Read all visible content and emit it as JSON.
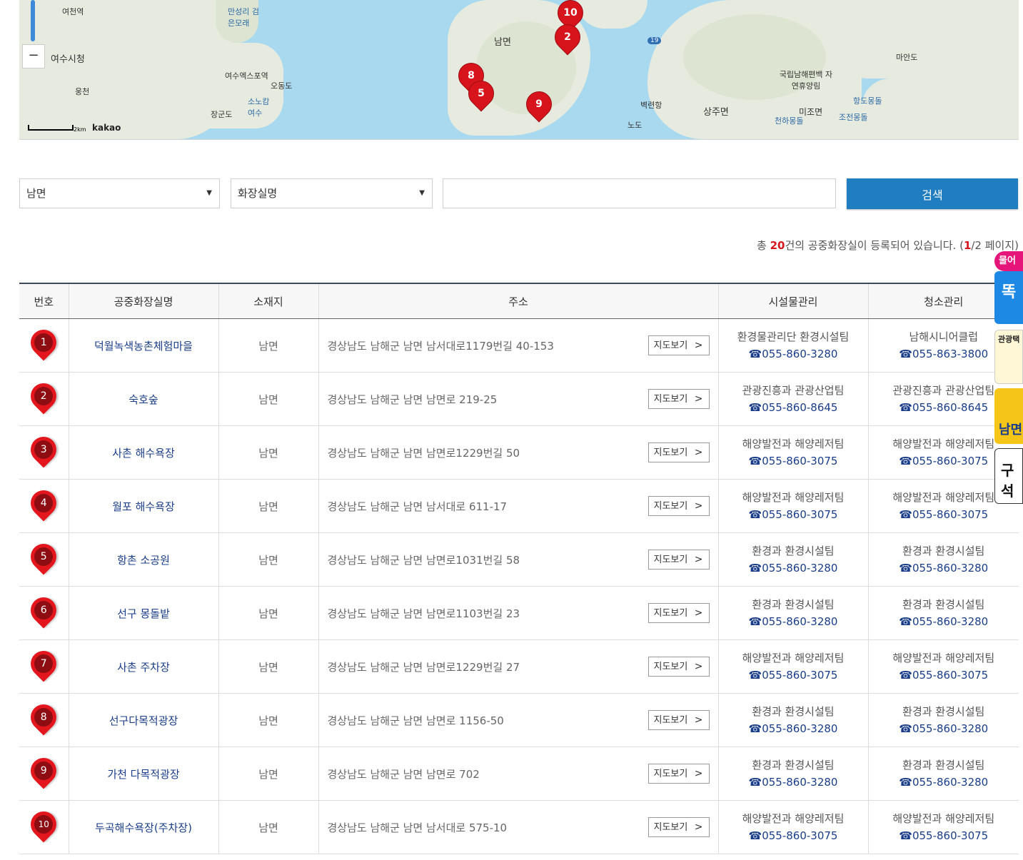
{
  "map": {
    "labels": [
      "여천역",
      "만성리 검은모래",
      "여수시청",
      "웅천",
      "여수엑스포역",
      "오동도",
      "소노캄 여수",
      "장군도",
      "남면",
      "국립남해편백 자연휴양림",
      "마안도",
      "항도몽돌",
      "미조면",
      "조전몽돌",
      "천하몽돌",
      "상주면",
      "벽련항",
      "노도"
    ],
    "road_number": "19",
    "zoom_out": "−",
    "scale": "2km",
    "brand": "kakao",
    "pins": [
      "10",
      "2",
      "8",
      "5",
      "9"
    ]
  },
  "search": {
    "region": "남면",
    "field": "화장실명",
    "query": "",
    "button": "검색"
  },
  "summary": {
    "prefix": "총 ",
    "count": "20",
    "middle": "건의 공중화장실이 등록되어 있습니다. (",
    "page": "1",
    "suffix": "/2 페이지)"
  },
  "table": {
    "headers": [
      "번호",
      "공중화장실명",
      "소재지",
      "주소",
      "시설물관리",
      "청소관리"
    ],
    "map_button": "지도보기",
    "rows": [
      {
        "no": "1",
        "name": "덕월녹색농촌체험마을",
        "loc": "남면",
        "addr": "경상남도 남해군 남면 남서대로1179번길 40-153",
        "fac": "환경물관리단 환경시설팀",
        "fac_tel": "☎055-860-3280",
        "clean": "남해시니어클럽",
        "clean_tel": "☎055-863-3800"
      },
      {
        "no": "2",
        "name": "숙호숲",
        "loc": "남면",
        "addr": "경상남도 남해군 남면 남면로 219-25",
        "fac": "관광진흥과 관광산업팀",
        "fac_tel": "☎055-860-8645",
        "clean": "관광진흥과 관광산업팀",
        "clean_tel": "☎055-860-8645"
      },
      {
        "no": "3",
        "name": "사촌 해수욕장",
        "loc": "남면",
        "addr": "경상남도 남해군 남면 남면로1229번길 50",
        "fac": "해양발전과 해양레저팀",
        "fac_tel": "☎055-860-3075",
        "clean": "해양발전과 해양레저팀",
        "clean_tel": "☎055-860-3075"
      },
      {
        "no": "4",
        "name": "월포 해수욕장",
        "loc": "남면",
        "addr": "경상남도 남해군 남면 남서대로 611-17",
        "fac": "해양발전과 해양레저팀",
        "fac_tel": "☎055-860-3075",
        "clean": "해양발전과 해양레저팀",
        "clean_tel": "☎055-860-3075"
      },
      {
        "no": "5",
        "name": "항촌 소공원",
        "loc": "남면",
        "addr": "경상남도 남해군 남면 남면로1031번길 58",
        "fac": "환경과 환경시설팀",
        "fac_tel": "☎055-860-3280",
        "clean": "환경과 환경시설팀",
        "clean_tel": "☎055-860-3280"
      },
      {
        "no": "6",
        "name": "선구 몽돌밭",
        "loc": "남면",
        "addr": "경상남도 남해군 남면 남면로1103번길 23",
        "fac": "환경과 환경시설팀",
        "fac_tel": "☎055-860-3280",
        "clean": "환경과 환경시설팀",
        "clean_tel": "☎055-860-3280"
      },
      {
        "no": "7",
        "name": "사촌 주차장",
        "loc": "남면",
        "addr": "경상남도 남해군 남면 남면로1229번길 27",
        "fac": "해양발전과 해양레저팀",
        "fac_tel": "☎055-860-3075",
        "clean": "해양발전과 해양레저팀",
        "clean_tel": "☎055-860-3075"
      },
      {
        "no": "8",
        "name": "선구다목적광장",
        "loc": "남면",
        "addr": "경상남도 남해군 남면 남면로 1156-50",
        "fac": "환경과 환경시설팀",
        "fac_tel": "☎055-860-3280",
        "clean": "환경과 환경시설팀",
        "clean_tel": "☎055-860-3280"
      },
      {
        "no": "9",
        "name": "가천 다목적광장",
        "loc": "남면",
        "addr": "경상남도 남해군 남면 남면로 702",
        "fac": "환경과 환경시설팀",
        "fac_tel": "☎055-860-3280",
        "clean": "환경과 환경시설팀",
        "clean_tel": "☎055-860-3280"
      },
      {
        "no": "10",
        "name": "두곡해수욕장(주차장)",
        "loc": "남면",
        "addr": "경상남도 남해군 남면 남서대로 575-10",
        "fac": "해양발전과 해양레저팀",
        "fac_tel": "☎055-860-3075",
        "clean": "해양발전과 해양레저팀",
        "clean_tel": "☎055-860-3075"
      }
    ]
  },
  "side_banners": [
    "물어",
    "똑",
    "관광택",
    "남면",
    "구석 남"
  ]
}
